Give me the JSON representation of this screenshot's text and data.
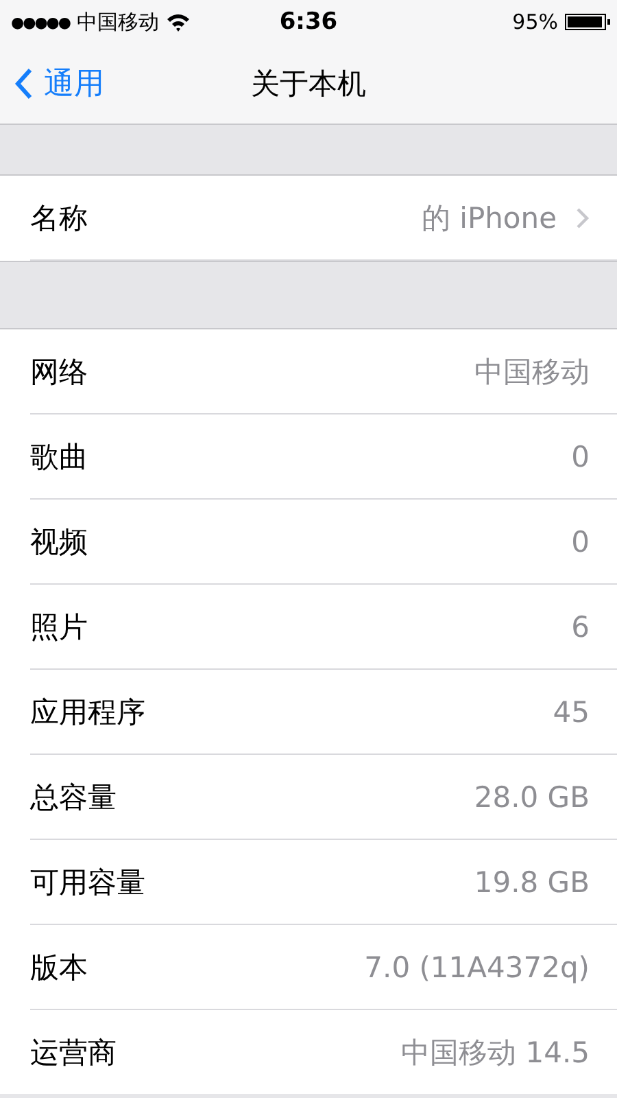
{
  "status_bar": {
    "signal_dots": "●●●●●",
    "carrier": "中国移动",
    "time": "6:36",
    "battery": "95%",
    "battery_icon": {
      "level": 0.95
    }
  },
  "nav": {
    "back": "通用",
    "title": "关于本机"
  },
  "name_row": {
    "label": "名称",
    "value": "的 iPhone"
  },
  "rows": [
    {
      "label": "网络",
      "value": "中国移动"
    },
    {
      "label": "歌曲",
      "value": "0"
    },
    {
      "label": "视频",
      "value": "0"
    },
    {
      "label": "照片",
      "value": "6"
    },
    {
      "label": "应用程序",
      "value": "45"
    },
    {
      "label": "总容量",
      "value": "28.0 GB"
    },
    {
      "label": "可用容量",
      "value": "19.8 GB"
    },
    {
      "label": "版本",
      "value": "7.0 (11A4372q)"
    },
    {
      "label": "运营商",
      "value": "中国移动 14.5"
    }
  ]
}
